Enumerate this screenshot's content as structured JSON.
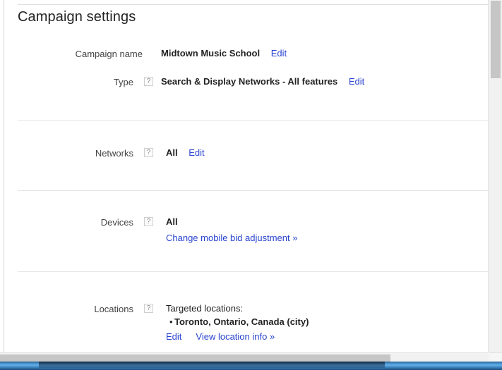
{
  "page": {
    "title": "Campaign settings"
  },
  "rows": {
    "campaign_name": {
      "label": "Campaign name",
      "value": "Midtown Music School",
      "edit_label": "Edit",
      "has_help": false
    },
    "type": {
      "label": "Type",
      "help_icon": "question-mark-icon",
      "help_glyph": "?",
      "value": "Search & Display Networks - All features",
      "edit_label": "Edit",
      "has_help": true
    },
    "networks": {
      "label": "Networks",
      "help_icon": "question-mark-icon",
      "help_glyph": "?",
      "value": "All",
      "edit_label": "Edit",
      "has_help": true
    },
    "devices": {
      "label": "Devices",
      "help_icon": "question-mark-icon",
      "help_glyph": "?",
      "value": "All",
      "bid_link_label": "Change mobile bid adjustment »",
      "has_help": true
    },
    "locations": {
      "label": "Locations",
      "help_icon": "question-mark-icon",
      "help_glyph": "?",
      "targeted_heading": "Targeted locations:",
      "bullet_glyph": "•",
      "targets": [
        "Toronto, Ontario, Canada (city)"
      ],
      "edit_label": "Edit",
      "view_info_label": "View location info »",
      "has_help": true
    }
  },
  "colors": {
    "link": "#2a44d0",
    "text": "#222222",
    "label": "#444444",
    "divider": "#e5e5e5",
    "scrollbar_track": "#f1f1f1",
    "scrollbar_thumb": "#c6c6c6",
    "taskbar_blue": "#3f88c5"
  }
}
